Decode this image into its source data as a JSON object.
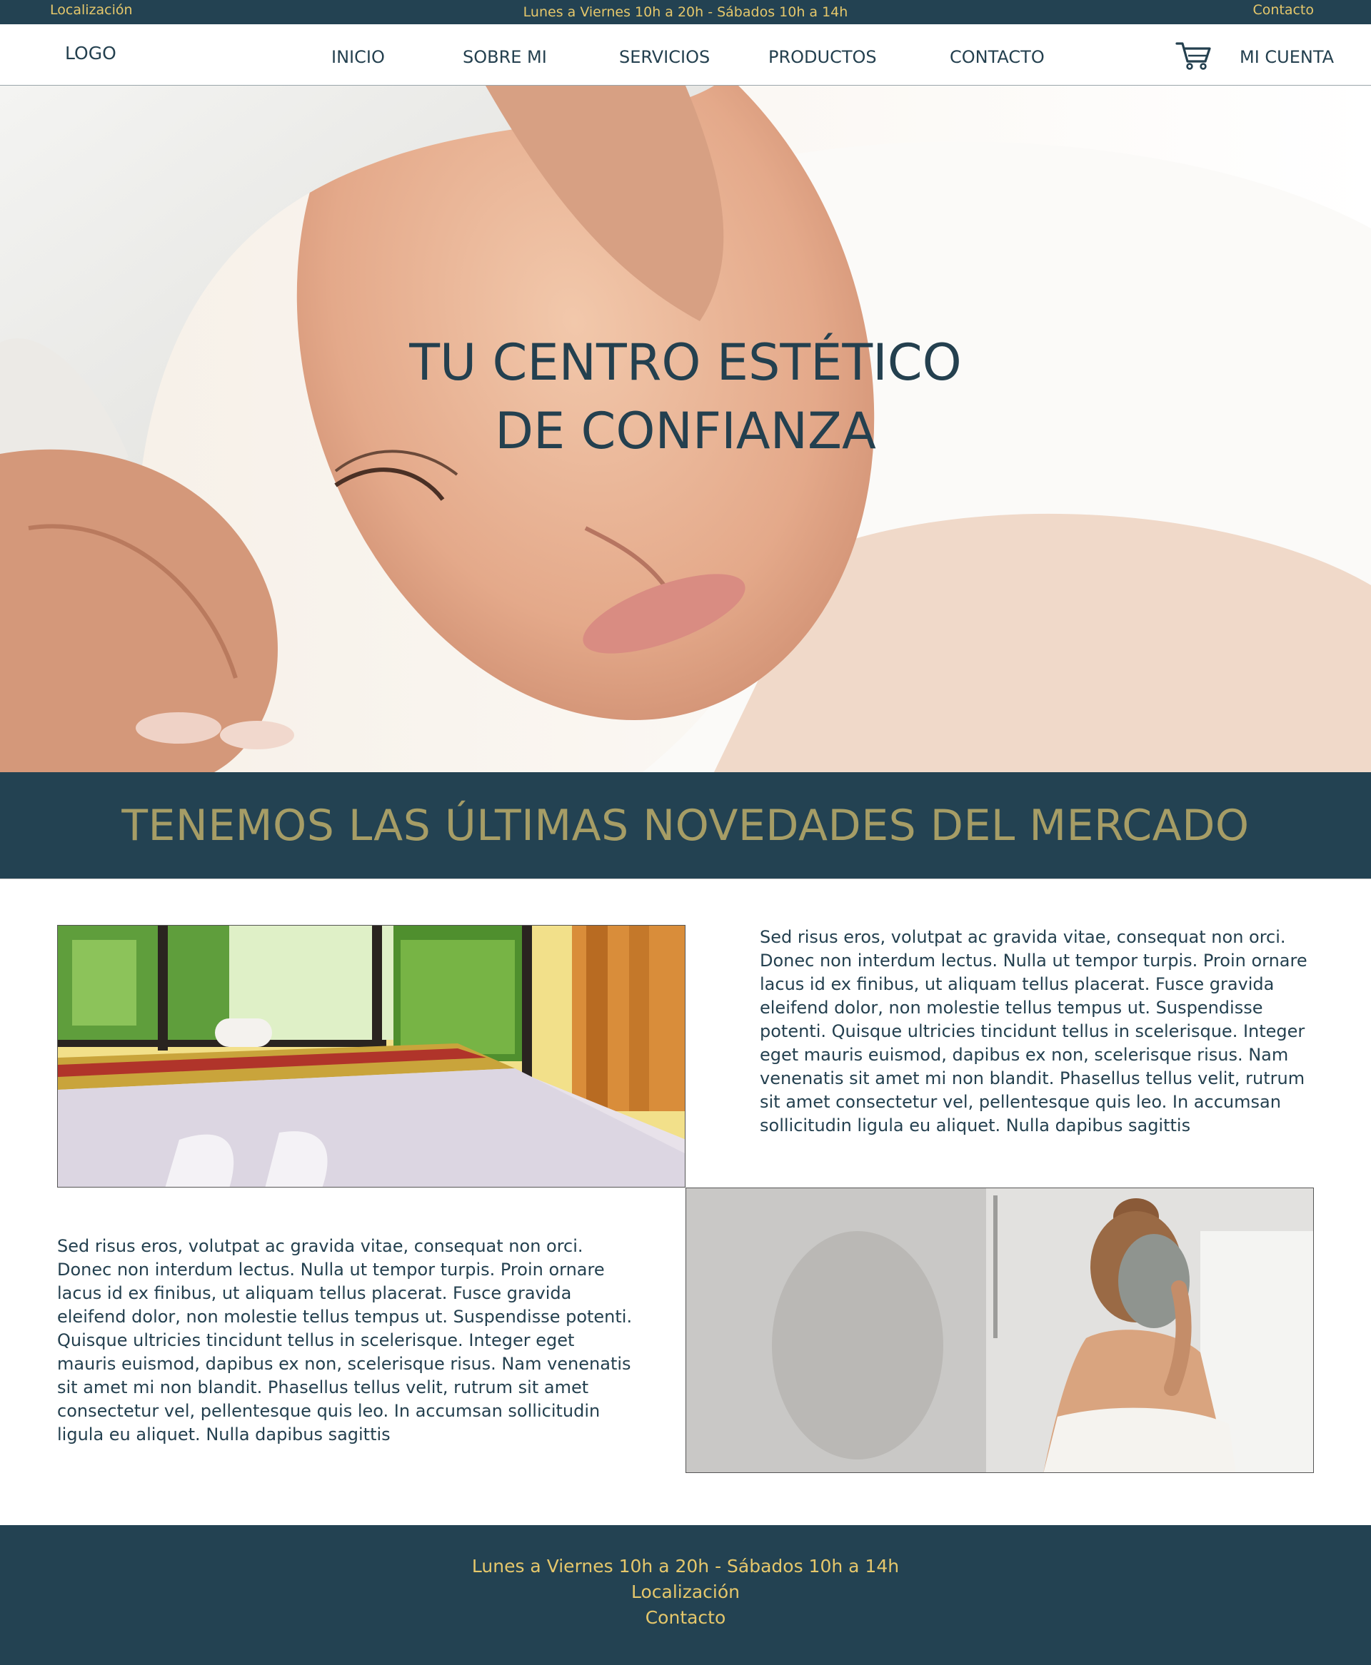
{
  "topbar": {
    "location": "Localización",
    "hours": "Lunes a Viernes 10h a 20h - Sábados 10h a 14h",
    "contact": "Contacto"
  },
  "header": {
    "logo": "LOGO",
    "nav": [
      "INICIO",
      "SOBRE MI",
      "SERVICIOS",
      "PRODUCTOS",
      "CONTACTO"
    ],
    "account": "MI CUENTA",
    "cart_icon": "cart-icon"
  },
  "hero": {
    "title_line1": "TU CENTRO ESTÉTICO",
    "title_line2": "DE CONFIANZA"
  },
  "band": {
    "title": "TENEMOS LAS ÚLTIMAS NOVEDADES DEL MERCADO"
  },
  "content": {
    "paragraph1": "Sed risus eros, volutpat ac gravida vitae, consequat non orci. Donec non interdum lectus. Nulla ut tempor turpis. Proin ornare lacus id ex finibus, ut aliquam tellus placerat. Fusce gravida eleifend dolor, non molestie tellus tempus ut. Suspendisse potenti. Quisque ultricies tincidunt tellus in scelerisque. Integer eget mauris euismod, dapibus ex non, scelerisque risus. Nam venenatis sit amet mi non blandit. Phasellus tellus velit, rutrum sit amet consectetur vel, pellentesque quis leo. In accumsan sollicitudin ligula eu aliquet. Nulla dapibus sagittis",
    "paragraph2": "Sed risus eros, volutpat ac gravida vitae, consequat non orci. Donec non interdum lectus. Nulla ut tempor turpis. Proin ornare lacus id ex finibus, ut aliquam tellus placerat. Fusce gravida eleifend dolor, non molestie tellus tempus ut. Suspendisse potenti. Quisque ultricies tincidunt tellus in scelerisque. Integer eget mauris euismod, dapibus ex non, scelerisque risus. Nam venenatis sit amet mi non blandit. Phasellus tellus velit, rutrum sit amet consectetur vel, pellentesque quis leo. In accumsan sollicitudin ligula eu aliquet. Nulla dapibus sagittis"
  },
  "footer": {
    "hours": "Lunes a Viernes 10h a 20h - Sábados 10h a 14h",
    "location": "Localización",
    "contact": "Contacto"
  },
  "colors": {
    "navy": "#234252",
    "gold": "#e5c76b",
    "olive": "#a69d66",
    "text": "#24404f"
  }
}
